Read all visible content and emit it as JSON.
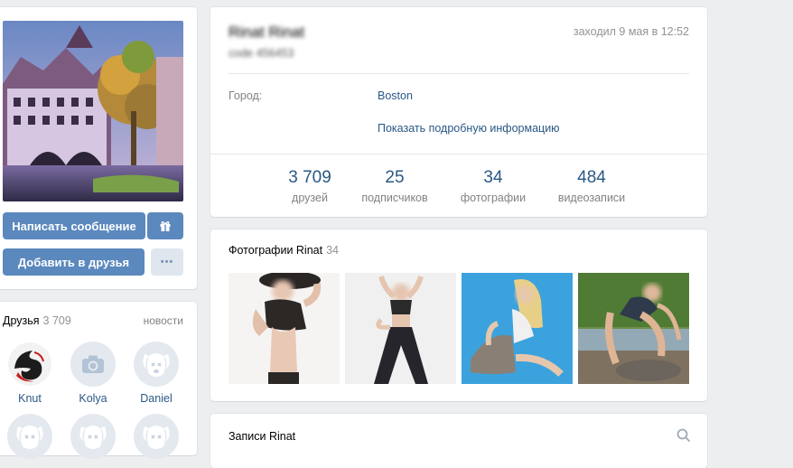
{
  "profile": {
    "name": "Rinat Rinat",
    "status": "code 456453",
    "last_seen": "заходил 9 мая в 12:52",
    "city_label": "Город:",
    "city_value": "Boston",
    "more_info": "Показать подробную информацию"
  },
  "stats": [
    {
      "value": "3 709",
      "label": "друзей"
    },
    {
      "value": "25",
      "label": "подписчиков"
    },
    {
      "value": "34",
      "label": "фотографии"
    },
    {
      "value": "484",
      "label": "видеозаписи"
    }
  ],
  "actions": {
    "message": "Написать сообщение",
    "add_friend": "Добавить в друзья",
    "more": "•••"
  },
  "friends": {
    "title": "Друзья",
    "count": "3 709",
    "news": "новости",
    "items": [
      {
        "name": "Knut"
      },
      {
        "name": "Kolya"
      },
      {
        "name": "Daniel"
      }
    ]
  },
  "photos": {
    "title": "Фотографии Rinat",
    "count": "34"
  },
  "posts": {
    "title": "Записи Rinat"
  },
  "colors": {
    "accent": "#5b88bd",
    "link": "#2a5885",
    "background": "#edeef0"
  },
  "icons": [
    "gift-icon",
    "camera-icon",
    "dog-placeholder-icon",
    "search-icon"
  ]
}
